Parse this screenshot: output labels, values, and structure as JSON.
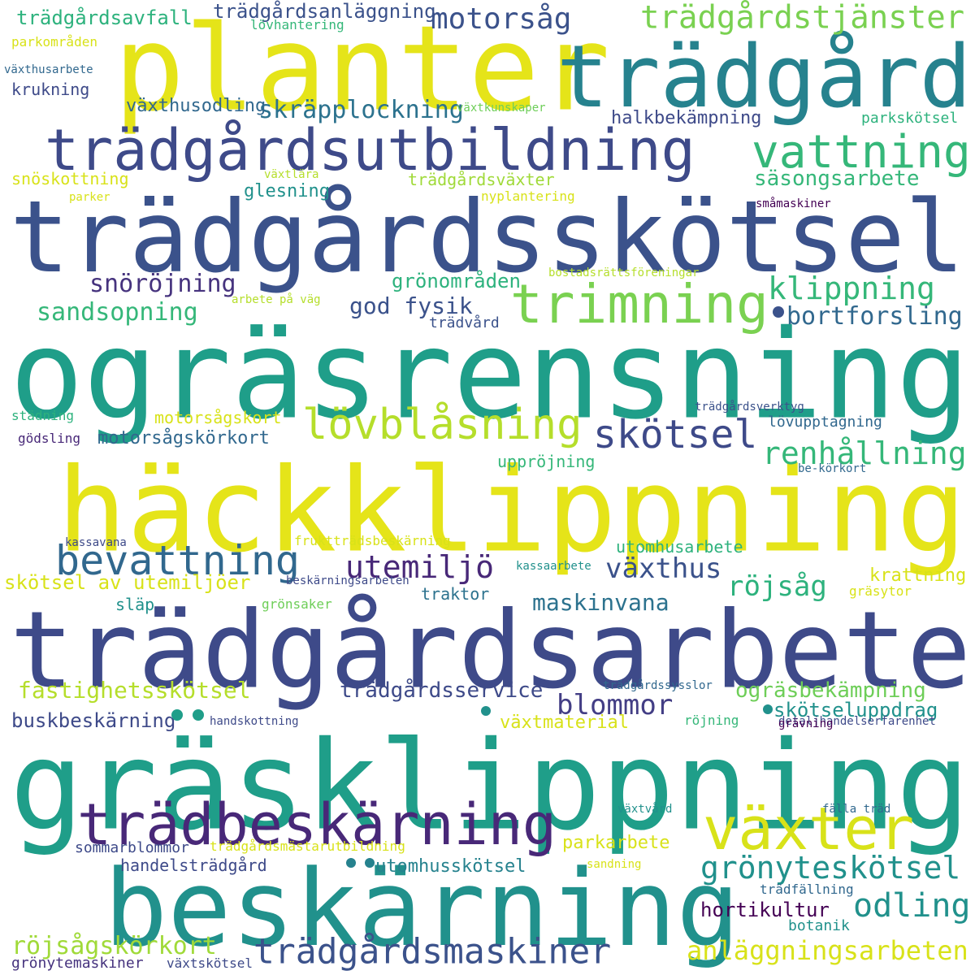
{
  "words": [
    {
      "text": "ogräsrensning",
      "color": "#1f9e89"
    },
    {
      "text": "gräsklippning",
      "color": "#1f9e89"
    },
    {
      "text": "trädgårdsskötsel",
      "color": "#3b528b"
    },
    {
      "text": "trädgårdsarbete",
      "color": "#3e4a89"
    },
    {
      "text": "häckklippning",
      "color": "#e5e419"
    },
    {
      "text": "planter",
      "color": "#e5e419"
    },
    {
      "text": "beskärning",
      "color": "#21918c"
    },
    {
      "text": "trädgård",
      "color": "#26828e"
    },
    {
      "text": "trädgårdsutbildning",
      "color": "#3e4a89"
    },
    {
      "text": "trädbeskärning",
      "color": "#482878"
    },
    {
      "text": "trimning",
      "color": "#7ad151"
    },
    {
      "text": "vattning",
      "color": "#35b779"
    },
    {
      "text": "växter",
      "color": "#d8e219"
    },
    {
      "text": "lövblåsning",
      "color": "#b5de2b"
    },
    {
      "text": "bevattning",
      "color": "#31688e"
    },
    {
      "text": "trädgårdsmaskiner",
      "color": "#3b528b"
    },
    {
      "text": "grönyteskötsel",
      "color": "#21918c"
    },
    {
      "text": "skötsel",
      "color": "#3e4a89"
    },
    {
      "text": "trädgårdstjänster",
      "color": "#7ad151"
    },
    {
      "text": "motorsåg",
      "color": "#3b528b"
    },
    {
      "text": "renhållning",
      "color": "#35b779"
    },
    {
      "text": "klippning",
      "color": "#35b779"
    },
    {
      "text": "odling",
      "color": "#21918c"
    },
    {
      "text": "utemiljö",
      "color": "#482878"
    },
    {
      "text": "anläggningsarbeten",
      "color": "#d8e219"
    },
    {
      "text": "röjsåg",
      "color": "#2db27d"
    },
    {
      "text": "växthus",
      "color": "#3b528b"
    },
    {
      "text": "blommor",
      "color": "#433e85"
    },
    {
      "text": "skräpplockning",
      "color": "#2c728e"
    },
    {
      "text": "bortforsling",
      "color": "#31688e"
    },
    {
      "text": "snöröjning",
      "color": "#46337e"
    },
    {
      "text": "sandsopning",
      "color": "#35b779"
    },
    {
      "text": "röjsågskörkort",
      "color": "#a0da39"
    },
    {
      "text": "fastighetsskötsel",
      "color": "#b5de2b"
    },
    {
      "text": "maskinvana",
      "color": "#2c728e"
    },
    {
      "text": "god fysik",
      "color": "#3b528b"
    },
    {
      "text": "säsongsarbete",
      "color": "#35b779"
    },
    {
      "text": "ogräsbekämpning",
      "color": "#6ece58"
    },
    {
      "text": "trädgårdsservice",
      "color": "#3e4a89"
    },
    {
      "text": "skötsel av utemiljöer",
      "color": "#d8e219"
    },
    {
      "text": "hortikultur",
      "color": "#440154"
    },
    {
      "text": "grönområden",
      "color": "#2db27d"
    },
    {
      "text": "skötseluppdrag",
      "color": "#21918c"
    },
    {
      "text": "buskbeskärning",
      "color": "#3e4a89"
    },
    {
      "text": "krattning",
      "color": "#d8e219"
    },
    {
      "text": "motorsågskörkort",
      "color": "#31688e"
    },
    {
      "text": "parkarbete",
      "color": "#d8e219"
    },
    {
      "text": "halkbekämpning",
      "color": "#3e4a89"
    },
    {
      "text": "trädgårdsavfall",
      "color": "#2db27d"
    },
    {
      "text": "trädgårdsanläggning",
      "color": "#3b528b"
    },
    {
      "text": "utomhusarbete",
      "color": "#2db27d"
    },
    {
      "text": "uppröjning",
      "color": "#35b779"
    },
    {
      "text": "växthusodling",
      "color": "#31688e"
    },
    {
      "text": "glesning",
      "color": "#21918c"
    },
    {
      "text": "traktor",
      "color": "#2c728e"
    },
    {
      "text": "handelsträdgård",
      "color": "#3e4a89"
    },
    {
      "text": "utomhusskötsel",
      "color": "#26828e"
    },
    {
      "text": "snöskottning",
      "color": "#d8e219"
    },
    {
      "text": "växtmaterial",
      "color": "#d8e219"
    },
    {
      "text": "trädgårdsväxter",
      "color": "#a0da39"
    },
    {
      "text": "motorsågskort",
      "color": "#d8e219"
    },
    {
      "text": "lövupptagning",
      "color": "#31688e"
    },
    {
      "text": "botanik",
      "color": "#21918c"
    },
    {
      "text": "parkskötsel",
      "color": "#2db27d"
    },
    {
      "text": "krukning",
      "color": "#3e4a89"
    },
    {
      "text": "sommarblommor",
      "color": "#3e4a89"
    },
    {
      "text": "släp",
      "color": "#21918c"
    },
    {
      "text": "trädvård",
      "color": "#3b528b"
    },
    {
      "text": "grönytemaskiner",
      "color": "#46337e"
    },
    {
      "text": "växtskötsel",
      "color": "#3e4a89"
    },
    {
      "text": "grönsaker",
      "color": "#6ece58"
    },
    {
      "text": "gödsling",
      "color": "#482878"
    },
    {
      "text": "städning",
      "color": "#2db27d"
    },
    {
      "text": "trädfällning",
      "color": "#31688e"
    },
    {
      "text": "trädgårdsmästarutbildning",
      "color": "#d8e219"
    },
    {
      "text": "fruktträdsbeskärning",
      "color": "#d8e219"
    },
    {
      "text": "nyplantering",
      "color": "#d8e219"
    },
    {
      "text": "lövhantering",
      "color": "#35b779"
    },
    {
      "text": "växtkunskaper",
      "color": "#6ece58"
    },
    {
      "text": "gräsytor",
      "color": "#d8e219"
    },
    {
      "text": "småmaskiner",
      "color": "#440154"
    },
    {
      "text": "bostadsrättsföreningar",
      "color": "#b5de2b"
    },
    {
      "text": "trädgårdsverktyg",
      "color": "#3b528b"
    },
    {
      "text": "detaljhandelserfarenhet",
      "color": "#3e4a89"
    },
    {
      "text": "röjning",
      "color": "#35b779"
    },
    {
      "text": "trädgårdssysslor",
      "color": "#31688e"
    },
    {
      "text": "parkområden",
      "color": "#d8e219"
    },
    {
      "text": "arbete på väg",
      "color": "#b5de2b"
    },
    {
      "text": "växthusarbete",
      "color": "#31688e"
    },
    {
      "text": "be-körkort",
      "color": "#31688e"
    },
    {
      "text": "sandning",
      "color": "#d8e219"
    },
    {
      "text": "växtvård",
      "color": "#21918c"
    },
    {
      "text": "fälla träd",
      "color": "#31688e"
    },
    {
      "text": "handskottning",
      "color": "#3e4a89"
    },
    {
      "text": "grävning",
      "color": "#440154"
    },
    {
      "text": "växtlära",
      "color": "#b5de2b"
    },
    {
      "text": "parker",
      "color": "#d8e219"
    },
    {
      "text": "kassavana",
      "color": "#3e4a89"
    },
    {
      "text": "beskärningsarbeten",
      "color": "#3e4a89"
    },
    {
      "text": "kassaarbete",
      "color": "#21918c"
    }
  ],
  "dots": [
    {
      "color": "#3b528b"
    },
    {
      "color": "#1f9e89"
    },
    {
      "color": "#1f9e89"
    },
    {
      "color": "#21918c"
    },
    {
      "color": "#21918c"
    },
    {
      "color": "#26828e"
    },
    {
      "color": "#26828e"
    }
  ]
}
